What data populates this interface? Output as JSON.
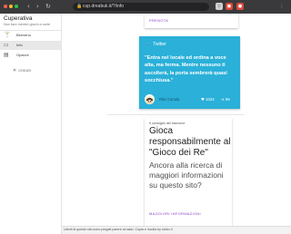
{
  "browser": {
    "url": "cup.dreabuk.it/?/info",
    "nav": {
      "back": "‹",
      "forward": "›",
      "reload": "↻"
    }
  },
  "sidebar": {
    "title": "Cuperativa",
    "subtitle": "Non fare mentre giochi a carte",
    "items": [
      {
        "label": "Benvenu",
        "icon": "cup-icon",
        "active": false
      },
      {
        "label": "Info",
        "icon": "info-icon",
        "active": true
      },
      {
        "label": "Opzioni",
        "icon": "settings-icon",
        "active": false
      }
    ],
    "close_label": "CHIUDI"
  },
  "main": {
    "top_card": {
      "link_label": "PRENOTA"
    },
    "twitter_card": {
      "source": "Twitter",
      "text": "\"Entra nel locale ed ordina a voce alta, ma ferma. Mentre nessuno ti ascolterà, la porta sembrerà quasi socchiusa.\"",
      "user": "Rita Cariola",
      "likes": "1024",
      "shares": "69",
      "color": "#2ab0d9"
    },
    "promo_card": {
      "kicker": "Il consiglio del bancone",
      "title": "Gioca responsabilmente al \"Gioco dei Re\"",
      "body": "Ancora alla ricerca di maggiori informazioni su questo sito?",
      "action_label": "MAGGIORI INFORMAZIONI",
      "accent": "#8e44c9"
    }
  },
  "cookie_bar": {
    "text": "Utenti di questo sito sono pregati parere al raido. Copia e incolla by mirko X"
  }
}
